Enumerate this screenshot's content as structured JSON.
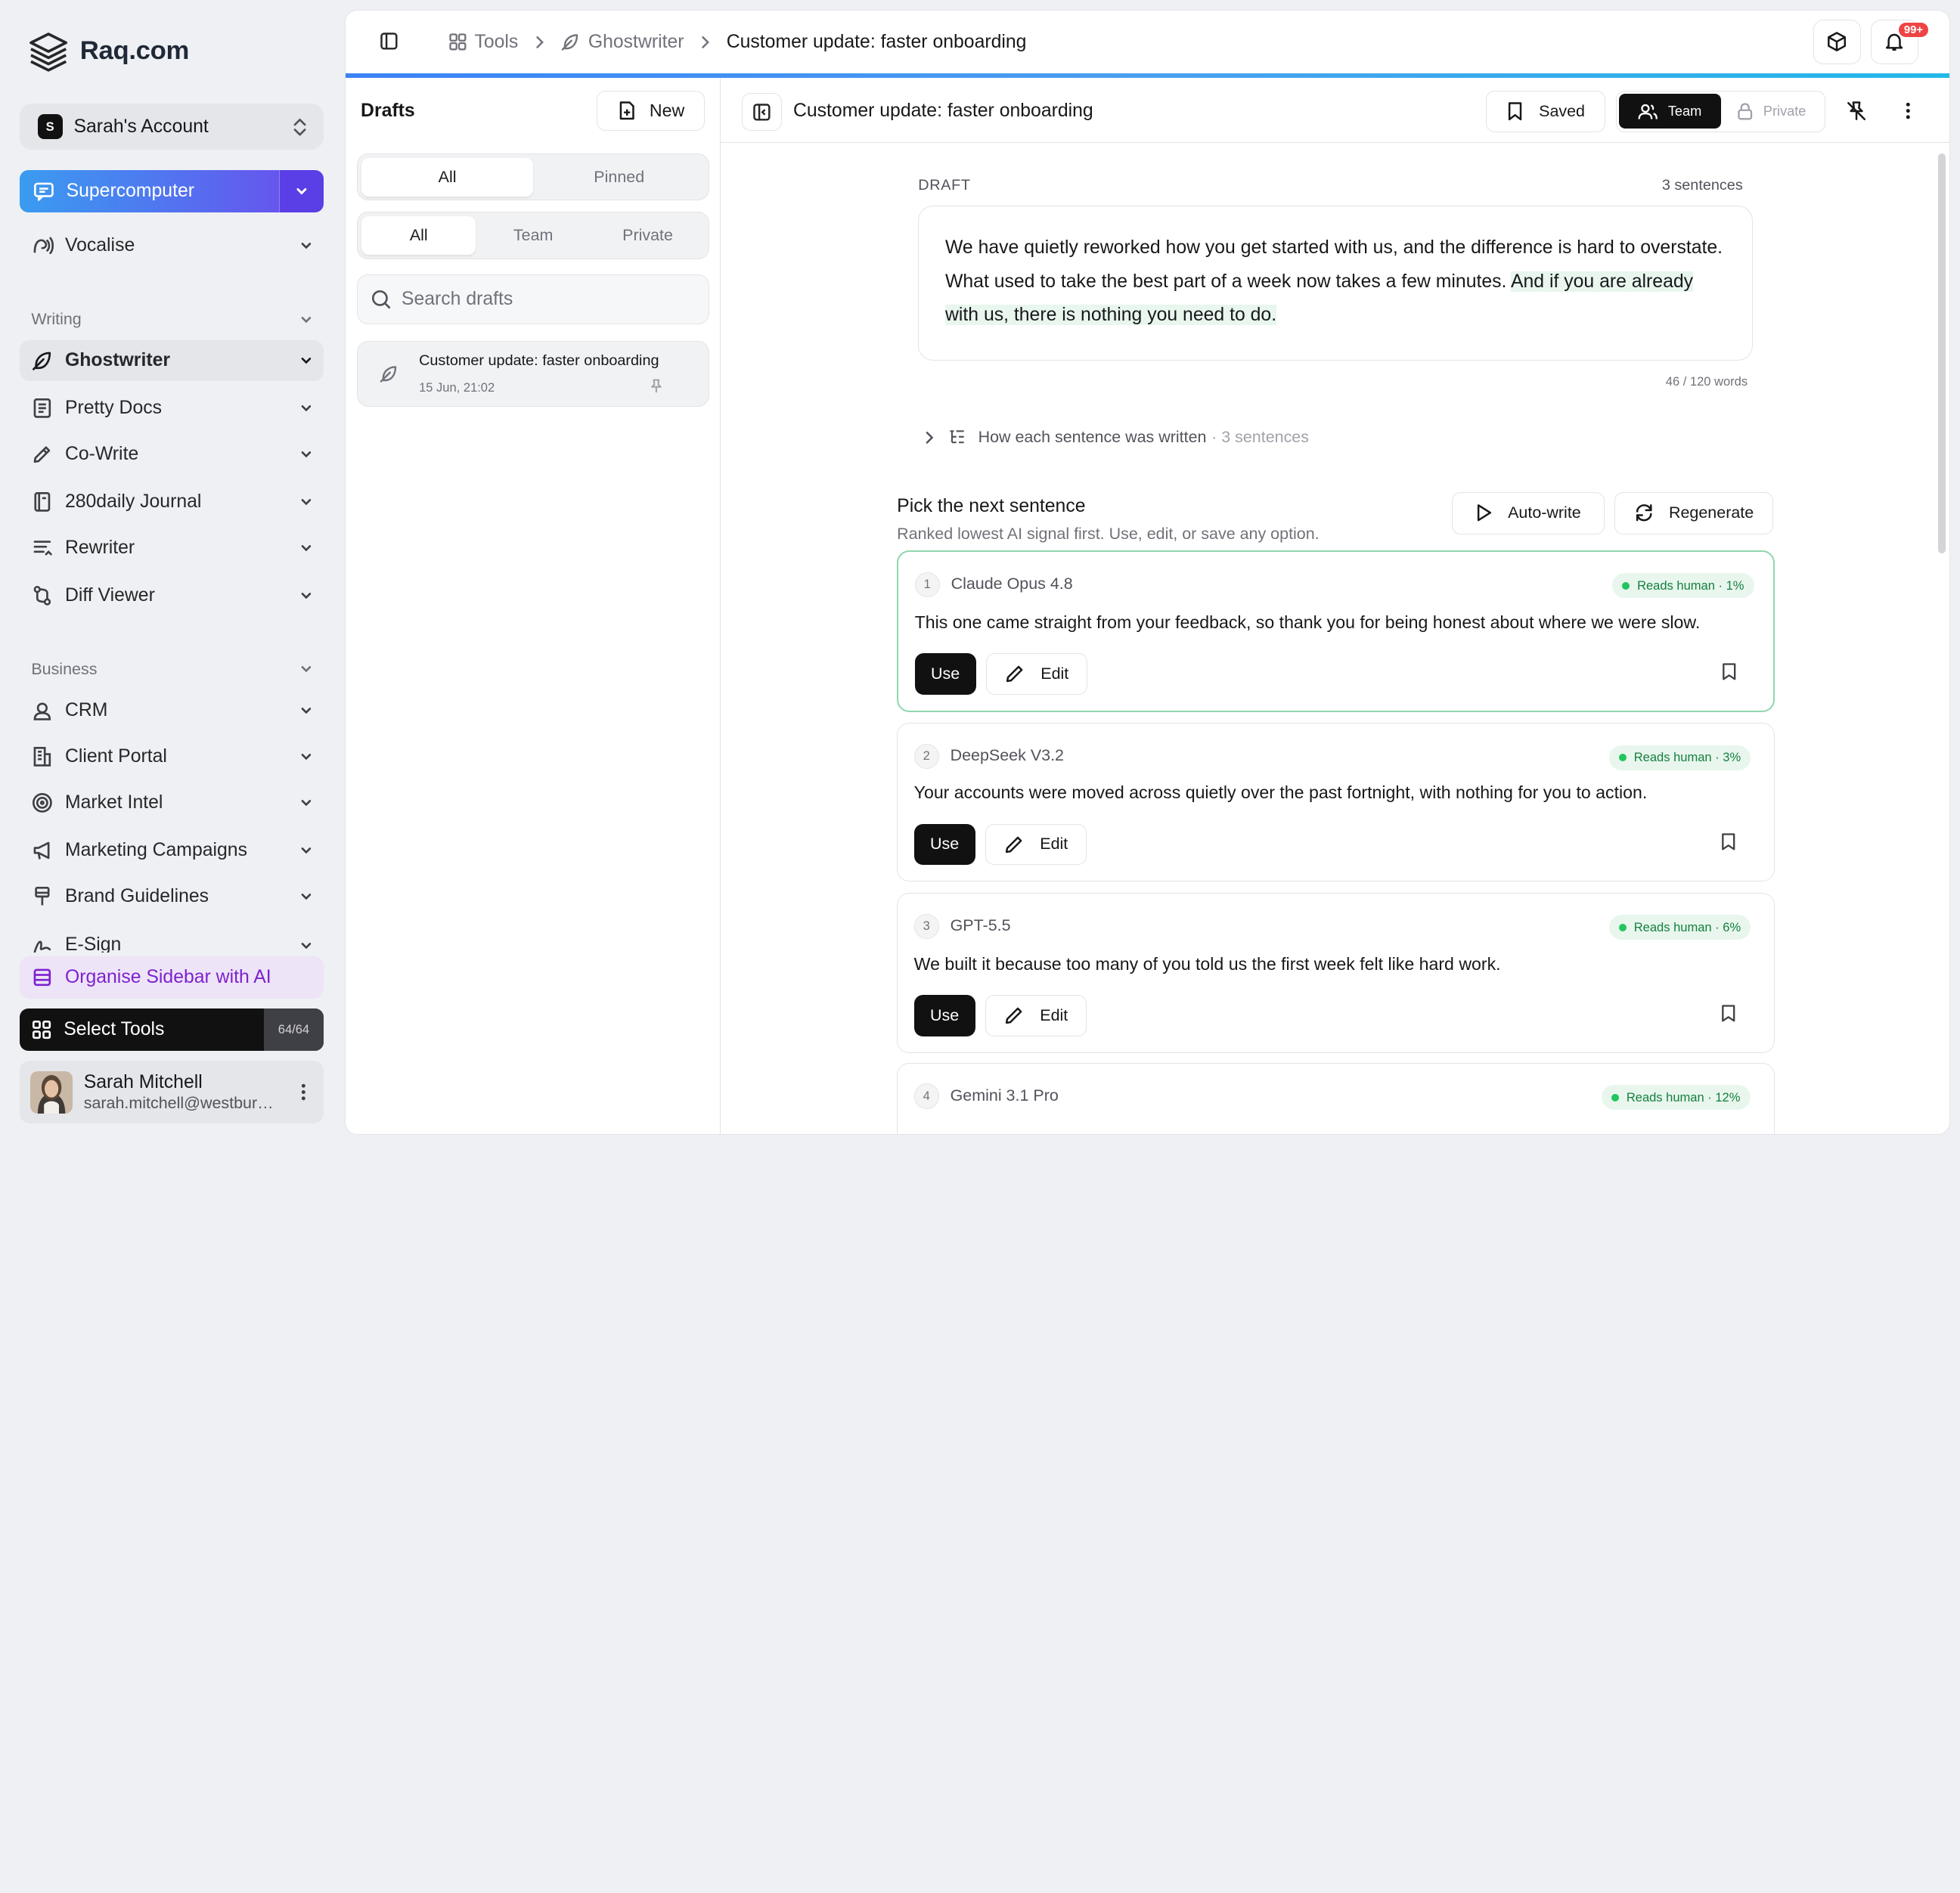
{
  "brand": {
    "name": "Raq.com"
  },
  "account": {
    "initial": "S",
    "name": "Sarah's Account"
  },
  "sidebar": {
    "supercomputer": "Supercomputer",
    "vocalise": "Vocalise",
    "writing_section": "Writing",
    "writing_items": [
      {
        "label": "Ghostwriter",
        "icon": "feather-icon"
      },
      {
        "label": "Pretty Docs",
        "icon": "doc-icon"
      },
      {
        "label": "Co-Write",
        "icon": "pen-icon"
      },
      {
        "label": "280daily Journal",
        "icon": "journal-icon"
      },
      {
        "label": "Rewriter",
        "icon": "lines-icon"
      },
      {
        "label": "Diff Viewer",
        "icon": "diff-icon"
      }
    ],
    "business_section": "Business",
    "business_items": [
      {
        "label": "CRM",
        "icon": "contact-icon"
      },
      {
        "label": "Client Portal",
        "icon": "building-icon"
      },
      {
        "label": "Market Intel",
        "icon": "target-icon"
      },
      {
        "label": "Marketing Campaigns",
        "icon": "megaphone-icon"
      },
      {
        "label": "Brand Guidelines",
        "icon": "brush-icon"
      },
      {
        "label": "E-Sign",
        "icon": "signature-icon"
      }
    ],
    "organise": "Organise Sidebar with AI",
    "select_tools": "Select Tools",
    "tools_count": "64/64",
    "user_name": "Sarah Mitchell",
    "user_email": "sarah.mitchell@westburyco.com"
  },
  "breadcrumb": {
    "tools": "Tools",
    "ghostwriter": "Ghostwriter",
    "current": "Customer update: faster onboarding"
  },
  "notifications": {
    "badge": "99+"
  },
  "drafts": {
    "title": "Drafts",
    "new_label": "New",
    "filter_primary": [
      "All",
      "Pinned"
    ],
    "filter_scope": [
      "All",
      "Team",
      "Private"
    ],
    "search_placeholder": "Search drafts",
    "items": [
      {
        "title": "Customer update: faster onboarding",
        "date": "15 Jun, 21:02"
      }
    ]
  },
  "editor": {
    "title": "Customer update: faster onboarding",
    "saved_label": "Saved",
    "team_label": "Team",
    "private_label": "Private",
    "draft_label": "DRAFT",
    "sentence_count": "3 sentences",
    "text_plain": "We have quietly reworked how you get started with us, and the difference is hard to overstate. What used to take the best part of a week now takes a few minutes. ",
    "text_highlight": "And if you are already with us, there is nothing you need to do.",
    "word_count": "46 / 120 words",
    "how_label": "How each sentence was written",
    "how_count": "· 3 sentences"
  },
  "pick": {
    "title": "Pick the next sentence",
    "subtitle": "Ranked lowest AI signal first. Use, edit, or save any option.",
    "autowrite": "Auto-write",
    "regenerate": "Regenerate",
    "use_label": "Use",
    "edit_label": "Edit",
    "options": [
      {
        "n": "1",
        "model": "Claude Opus 4.8",
        "score": "Reads human · 1%",
        "text": "This one came straight from your feedback, so thank you for being honest about where we were slow."
      },
      {
        "n": "2",
        "model": "DeepSeek V3.2",
        "score": "Reads human · 3%",
        "text": "Your accounts were moved across quietly over the past fortnight, with nothing for you to action."
      },
      {
        "n": "3",
        "model": "GPT-5.5",
        "score": "Reads human · 6%",
        "text": "We built it because too many of you told us the first week felt like hard work."
      },
      {
        "n": "4",
        "model": "Gemini 3.1 Pro",
        "score": "Reads human · 12%",
        "text": ""
      }
    ]
  }
}
